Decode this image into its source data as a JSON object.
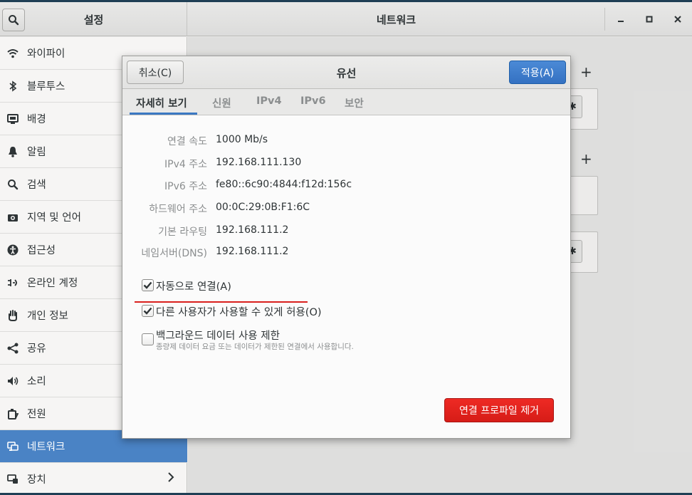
{
  "headerbar": {
    "left_title": "설정",
    "right_title": "네트워크",
    "minimize": "–",
    "maximize": "□",
    "close": "×"
  },
  "sidebar": {
    "items": [
      {
        "label": "와이파이",
        "icon": "wifi-icon"
      },
      {
        "label": "블루투스",
        "icon": "bluetooth-icon"
      },
      {
        "label": "배경",
        "icon": "background-icon"
      },
      {
        "label": "알림",
        "icon": "bell-icon"
      },
      {
        "label": "검색",
        "icon": "search-icon"
      },
      {
        "label": "지역 및 언어",
        "icon": "camera-icon"
      },
      {
        "label": "접근성",
        "icon": "accessibility-icon"
      },
      {
        "label": "온라인 계정",
        "icon": "online-accounts-icon"
      },
      {
        "label": "개인 정보",
        "icon": "hand-icon"
      },
      {
        "label": "공유",
        "icon": "share-icon"
      },
      {
        "label": "소리",
        "icon": "speaker-icon"
      },
      {
        "label": "전원",
        "icon": "power-icon"
      },
      {
        "label": "네트워크",
        "icon": "network-icon",
        "active": true
      },
      {
        "label": "장치",
        "icon": "devices-icon",
        "chevron": true
      }
    ]
  },
  "dialog": {
    "cancel_label": "취소(C)",
    "title": "유선",
    "apply_label": "적용(A)",
    "tabs": [
      "자세히 보기",
      "신원",
      "IPv4",
      "IPv6",
      "보안"
    ],
    "details": [
      {
        "label": "연결 속도",
        "value": "1000 Mb/s"
      },
      {
        "label": "IPv4 주소",
        "value": "192.168.111.130"
      },
      {
        "label": "IPv6 주소",
        "value": "fe80::6c90:4844:f12d:156c"
      },
      {
        "label": "하드웨어 주소",
        "value": "00:0C:29:0B:F1:6C"
      },
      {
        "label": "기본 라우팅",
        "value": "192.168.111.2"
      },
      {
        "label": "네임서버(DNS)",
        "value": "192.168.111.2"
      }
    ],
    "checkboxes": [
      {
        "label": "자동으로 연결(A)",
        "checked": true
      },
      {
        "label": "다른 사용자가 사용할 수 있게 허용(O)",
        "checked": true
      },
      {
        "label": "백그라운드 데이터 사용 제한",
        "checked": false,
        "sublabel": "종량제 데이터 요금 또는 데이터가 제한된 연결에서 사용합니다."
      }
    ],
    "remove_label": "연결 프로파일 제거"
  },
  "colors": {
    "accent": "#4a83c5",
    "apply": "#3b78c2",
    "danger": "#e0221d",
    "annotation": "#d9201d"
  }
}
